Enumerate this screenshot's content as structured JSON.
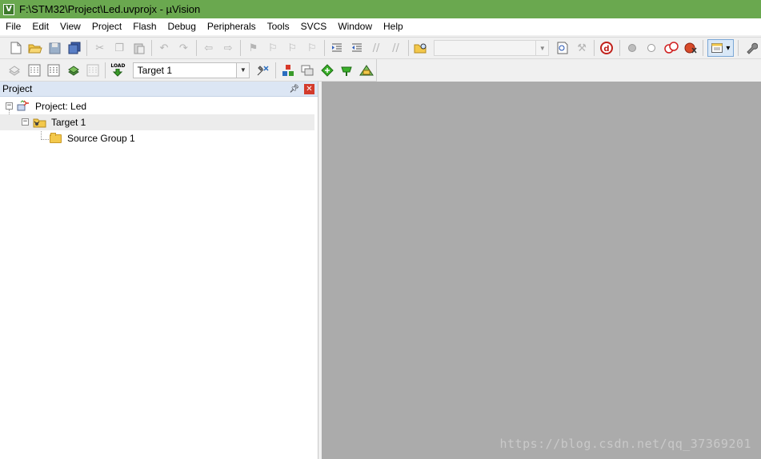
{
  "window": {
    "title": "F:\\STM32\\Project\\Led.uvprojx - µVision",
    "app_icon_letter": "V"
  },
  "menu": [
    "File",
    "Edit",
    "View",
    "Project",
    "Flash",
    "Debug",
    "Peripherals",
    "Tools",
    "SVCS",
    "Window",
    "Help"
  ],
  "toolbar_build": {
    "load_label": "LOAD",
    "target_select": "Target 1"
  },
  "project_panel": {
    "title": "Project",
    "tree": {
      "root": "Project: Led",
      "target": "Target 1",
      "group": "Source Group 1"
    }
  },
  "watermark": "https://blog.csdn.net/qq_37369201",
  "colors": {
    "titlebar": "#6aa84f",
    "panel_header": "#dce6f4",
    "editor_background": "#ababab",
    "close_button": "#d33b2c"
  }
}
